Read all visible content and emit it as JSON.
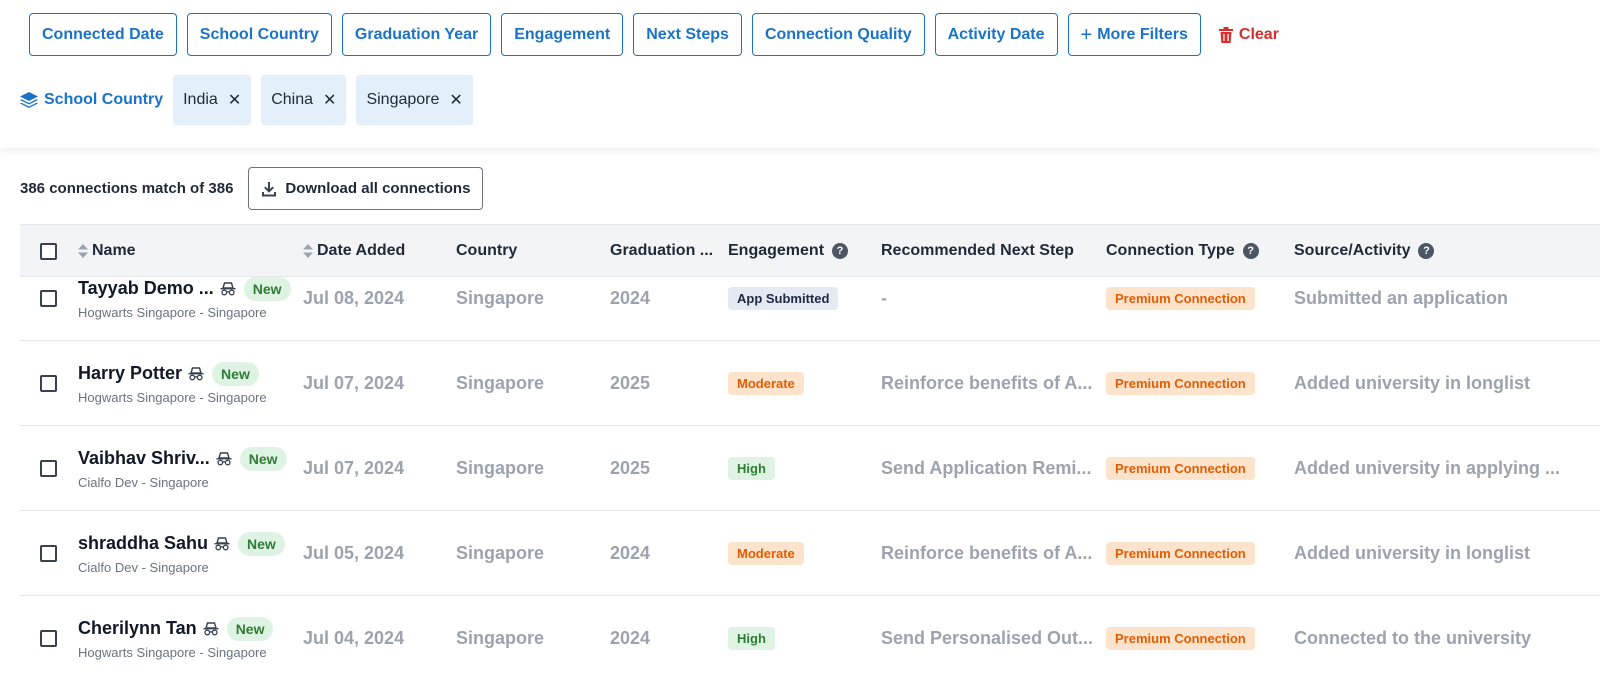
{
  "filters": {
    "buttons": [
      "Connected Date",
      "School Country",
      "Graduation Year",
      "Engagement",
      "Next Steps",
      "Connection Quality",
      "Activity Date"
    ],
    "more_filters_label": "More Filters",
    "clear_label": "Clear",
    "active": {
      "label": "School Country",
      "tags": [
        "India",
        "China",
        "Singapore"
      ]
    }
  },
  "summary": {
    "match_text": "386 connections match of 386",
    "download_label": "Download all connections"
  },
  "table": {
    "headers": {
      "name": "Name",
      "date_added": "Date Added",
      "country": "Country",
      "graduation": "Graduation ...",
      "engagement": "Engagement",
      "next_step": "Recommended Next Step",
      "connection_type": "Connection Type",
      "source": "Source/Activity"
    },
    "rows": [
      {
        "name": "Tayyab Demo ...",
        "badge": "New",
        "school": "Hogwarts Singapore - Singapore",
        "date": "Jul 08, 2024",
        "country": "Singapore",
        "year": "2024",
        "engagement": "App Submitted",
        "engagement_type": "app",
        "next_step": "-",
        "connection_type": "Premium Connection",
        "source": "Submitted an application"
      },
      {
        "name": "Harry Potter",
        "badge": "New",
        "school": "Hogwarts Singapore - Singapore",
        "date": "Jul 07, 2024",
        "country": "Singapore",
        "year": "2025",
        "engagement": "Moderate",
        "engagement_type": "moderate",
        "next_step": "Reinforce benefits of A...",
        "connection_type": "Premium Connection",
        "source": "Added university in longlist"
      },
      {
        "name": "Vaibhav Shriv...",
        "badge": "New",
        "school": "Cialfo Dev - Singapore",
        "date": "Jul 07, 2024",
        "country": "Singapore",
        "year": "2025",
        "engagement": "High",
        "engagement_type": "high",
        "next_step": "Send Application Remi...",
        "connection_type": "Premium Connection",
        "source": "Added university in applying ..."
      },
      {
        "name": "shraddha Sahu",
        "badge": "New",
        "school": "Cialfo Dev - Singapore",
        "date": "Jul 05, 2024",
        "country": "Singapore",
        "year": "2024",
        "engagement": "Moderate",
        "engagement_type": "moderate",
        "next_step": "Reinforce benefits of A...",
        "connection_type": "Premium Connection",
        "source": "Added university in longlist"
      },
      {
        "name": "Cherilynn Tan",
        "badge": "New",
        "school": "Hogwarts Singapore - Singapore",
        "date": "Jul 04, 2024",
        "country": "Singapore",
        "year": "2024",
        "engagement": "High",
        "engagement_type": "high",
        "next_step": "Send Personalised Out...",
        "connection_type": "Premium Connection",
        "source": "Connected to the university"
      }
    ]
  },
  "colors": {
    "accent": "#1a73c8",
    "danger": "#d32f2f",
    "high": "#2e7d32",
    "moderate": "#e65c00"
  }
}
